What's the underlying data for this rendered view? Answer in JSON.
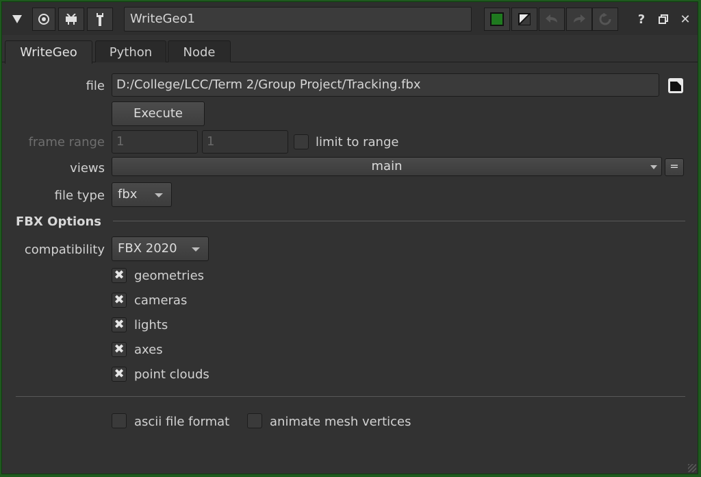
{
  "window": {
    "node_name": "WriteGeo1",
    "icons": [
      "collapse-triangle-icon",
      "view-node-icon",
      "viewer-icon",
      "wrench-icon",
      "node-color-icon",
      "node-color-half-icon",
      "undo-icon",
      "redo-icon",
      "revert-icon",
      "help-icon",
      "float-icon",
      "close-icon"
    ],
    "help": "?",
    "close": "✕"
  },
  "tabs": [
    {
      "label": "WriteGeo",
      "active": true
    },
    {
      "label": "Python",
      "active": false
    },
    {
      "label": "Node",
      "active": false
    }
  ],
  "knobs": {
    "file_label": "file",
    "file_value": "D:/College/LCC/Term 2/Group Project/Tracking.fbx",
    "execute_label": "Execute",
    "frame_range_label": "frame range",
    "frame_start": "1",
    "frame_end": "1",
    "limit_to_range": "limit to range",
    "views_label": "views",
    "views_value": "main",
    "views_eq": "=",
    "file_type_label": "file type",
    "file_type_value": "fbx"
  },
  "fbx_options": {
    "header": "FBX Options",
    "compatibility_label": "compatibility",
    "compatibility_value": "FBX 2020",
    "checkboxes": [
      {
        "label": "geometries",
        "checked": true
      },
      {
        "label": "cameras",
        "checked": true
      },
      {
        "label": "lights",
        "checked": true
      },
      {
        "label": "axes",
        "checked": true
      },
      {
        "label": "point clouds",
        "checked": true
      }
    ],
    "ascii_file_format": {
      "label": "ascii file format",
      "checked": false
    },
    "animate_mesh_vertices": {
      "label": "animate mesh vertices",
      "checked": false
    }
  },
  "colors": {
    "node_color": "#1f7a1f",
    "accent_border": "#1e5a1e"
  }
}
